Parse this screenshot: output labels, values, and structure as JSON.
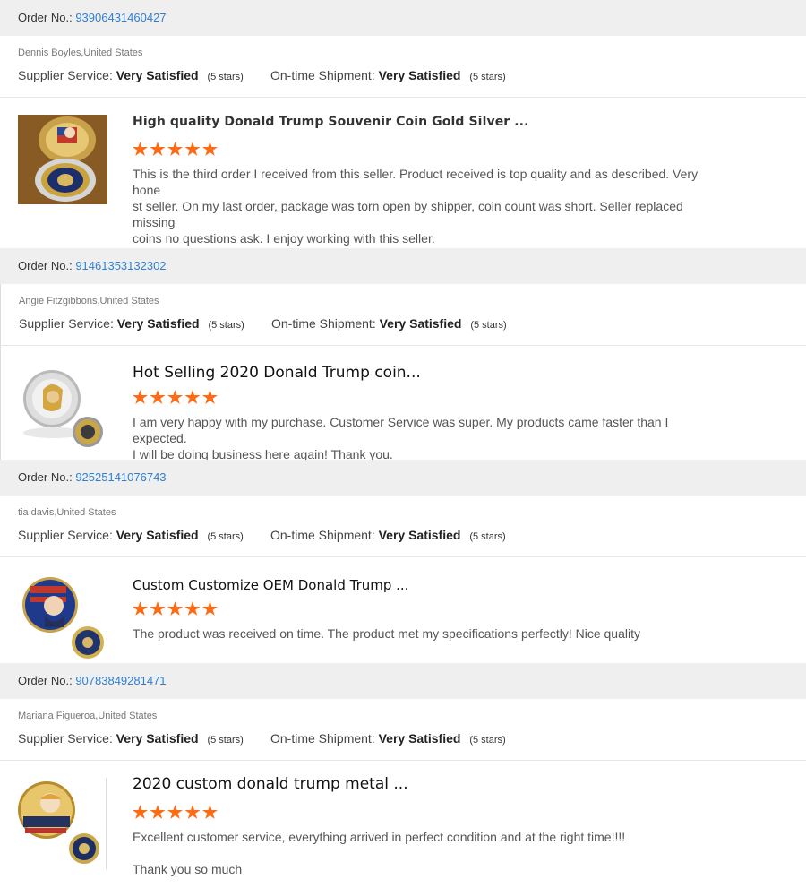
{
  "labels": {
    "order_no": "Order No.:",
    "supplier_service": "Supplier Service:",
    "ontime_shipment": "On-time Shipment:"
  },
  "colors": {
    "star": "#ff6a14",
    "order_link": "#2f7fd0",
    "bar_bg": "#efefef"
  },
  "reviews": [
    {
      "order_no": "93906431460427",
      "buyer": "Dennis Boyles,United States",
      "supplier_value": "Very Satisfied",
      "supplier_stars": "(5 stars)",
      "shipment_value": "Very Satisfied",
      "shipment_stars": "(5 stars)",
      "product_title": "High quality Donald Trump Souvenir Coin Gold Silver ...",
      "product_image": "gold-silver-coin-photo",
      "rating": 5,
      "comment": "This is the third order I received from this seller. Product received is top quality and as described. Very honest seller. On my last order, package was torn open by shipper, coin count was short. Seller replaced missing coins no questions ask. I enjoy working with this seller.",
      "comment_lines": [
        "This is the third order I received from this seller. Product received is top quality and as described. Very hone",
        "st seller. On my last order, package was torn open by shipper, coin count was short. Seller replaced missing",
        "coins no questions ask. I enjoy working with this seller."
      ]
    },
    {
      "order_no": "91461353132302",
      "buyer": "Angie Fitzgibbons,United States",
      "supplier_value": "Very Satisfied",
      "supplier_stars": "(5 stars)",
      "shipment_value": "Very Satisfied",
      "shipment_stars": "(5 stars)",
      "product_title": "Hot Selling 2020 Donald Trump coin...",
      "product_image": "silver-gold-coin-photo",
      "rating": 5,
      "comment_lines": [
        "I am very happy with my purchase. Customer Service was super. My products came faster than I expected.",
        "I will be doing business here again! Thank you."
      ]
    },
    {
      "order_no": "92525141076743",
      "buyer": "tia davis,United States",
      "supplier_value": "Very Satisfied",
      "supplier_stars": "(5 stars)",
      "shipment_value": "Very Satisfied",
      "shipment_stars": "(5 stars)",
      "product_title": "Custom Customize OEM Donald Trump ...",
      "product_image": "blue-flag-coin-photo",
      "rating": 5,
      "comment_lines": [
        "The product was received on time. The product met my specifications perfectly!  Nice quality"
      ]
    },
    {
      "order_no": "90783849281471",
      "buyer": "Mariana Figueroa,United States",
      "supplier_value": "Very Satisfied",
      "supplier_stars": "(5 stars)",
      "shipment_value": "Very Satisfied",
      "shipment_stars": "(5 stars)",
      "product_title": "2020 custom donald trump metal ...",
      "product_image": "trump-2020-coin-photo",
      "rating": 5,
      "comment_lines": [
        "Excellent customer service, everything arrived in perfect condition and at the right time!!!!",
        "",
        "Thank you so much"
      ]
    }
  ]
}
